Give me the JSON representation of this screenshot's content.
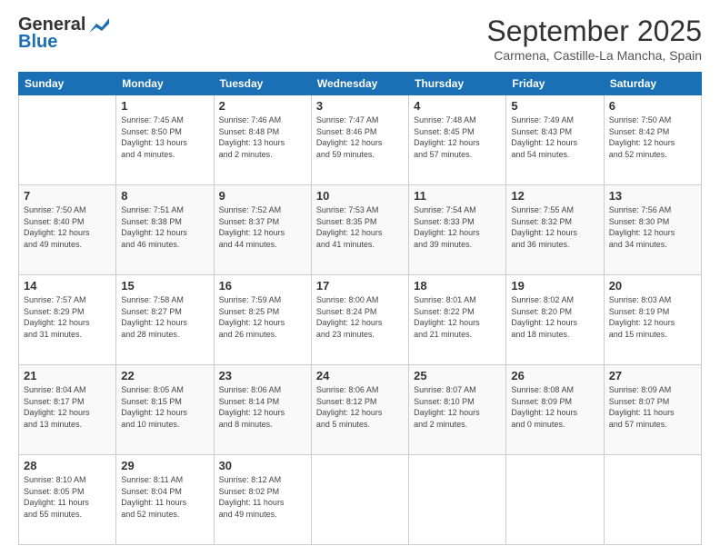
{
  "header": {
    "logo_general": "General",
    "logo_blue": "Blue",
    "title": "September 2025",
    "subtitle": "Carmena, Castille-La Mancha, Spain"
  },
  "days_of_week": [
    "Sunday",
    "Monday",
    "Tuesday",
    "Wednesday",
    "Thursday",
    "Friday",
    "Saturday"
  ],
  "weeks": [
    [
      {
        "day": "",
        "info": ""
      },
      {
        "day": "1",
        "info": "Sunrise: 7:45 AM\nSunset: 8:50 PM\nDaylight: 13 hours\nand 4 minutes."
      },
      {
        "day": "2",
        "info": "Sunrise: 7:46 AM\nSunset: 8:48 PM\nDaylight: 13 hours\nand 2 minutes."
      },
      {
        "day": "3",
        "info": "Sunrise: 7:47 AM\nSunset: 8:46 PM\nDaylight: 12 hours\nand 59 minutes."
      },
      {
        "day": "4",
        "info": "Sunrise: 7:48 AM\nSunset: 8:45 PM\nDaylight: 12 hours\nand 57 minutes."
      },
      {
        "day": "5",
        "info": "Sunrise: 7:49 AM\nSunset: 8:43 PM\nDaylight: 12 hours\nand 54 minutes."
      },
      {
        "day": "6",
        "info": "Sunrise: 7:50 AM\nSunset: 8:42 PM\nDaylight: 12 hours\nand 52 minutes."
      }
    ],
    [
      {
        "day": "7",
        "info": "Sunrise: 7:50 AM\nSunset: 8:40 PM\nDaylight: 12 hours\nand 49 minutes."
      },
      {
        "day": "8",
        "info": "Sunrise: 7:51 AM\nSunset: 8:38 PM\nDaylight: 12 hours\nand 46 minutes."
      },
      {
        "day": "9",
        "info": "Sunrise: 7:52 AM\nSunset: 8:37 PM\nDaylight: 12 hours\nand 44 minutes."
      },
      {
        "day": "10",
        "info": "Sunrise: 7:53 AM\nSunset: 8:35 PM\nDaylight: 12 hours\nand 41 minutes."
      },
      {
        "day": "11",
        "info": "Sunrise: 7:54 AM\nSunset: 8:33 PM\nDaylight: 12 hours\nand 39 minutes."
      },
      {
        "day": "12",
        "info": "Sunrise: 7:55 AM\nSunset: 8:32 PM\nDaylight: 12 hours\nand 36 minutes."
      },
      {
        "day": "13",
        "info": "Sunrise: 7:56 AM\nSunset: 8:30 PM\nDaylight: 12 hours\nand 34 minutes."
      }
    ],
    [
      {
        "day": "14",
        "info": "Sunrise: 7:57 AM\nSunset: 8:29 PM\nDaylight: 12 hours\nand 31 minutes."
      },
      {
        "day": "15",
        "info": "Sunrise: 7:58 AM\nSunset: 8:27 PM\nDaylight: 12 hours\nand 28 minutes."
      },
      {
        "day": "16",
        "info": "Sunrise: 7:59 AM\nSunset: 8:25 PM\nDaylight: 12 hours\nand 26 minutes."
      },
      {
        "day": "17",
        "info": "Sunrise: 8:00 AM\nSunset: 8:24 PM\nDaylight: 12 hours\nand 23 minutes."
      },
      {
        "day": "18",
        "info": "Sunrise: 8:01 AM\nSunset: 8:22 PM\nDaylight: 12 hours\nand 21 minutes."
      },
      {
        "day": "19",
        "info": "Sunrise: 8:02 AM\nSunset: 8:20 PM\nDaylight: 12 hours\nand 18 minutes."
      },
      {
        "day": "20",
        "info": "Sunrise: 8:03 AM\nSunset: 8:19 PM\nDaylight: 12 hours\nand 15 minutes."
      }
    ],
    [
      {
        "day": "21",
        "info": "Sunrise: 8:04 AM\nSunset: 8:17 PM\nDaylight: 12 hours\nand 13 minutes."
      },
      {
        "day": "22",
        "info": "Sunrise: 8:05 AM\nSunset: 8:15 PM\nDaylight: 12 hours\nand 10 minutes."
      },
      {
        "day": "23",
        "info": "Sunrise: 8:06 AM\nSunset: 8:14 PM\nDaylight: 12 hours\nand 8 minutes."
      },
      {
        "day": "24",
        "info": "Sunrise: 8:06 AM\nSunset: 8:12 PM\nDaylight: 12 hours\nand 5 minutes."
      },
      {
        "day": "25",
        "info": "Sunrise: 8:07 AM\nSunset: 8:10 PM\nDaylight: 12 hours\nand 2 minutes."
      },
      {
        "day": "26",
        "info": "Sunrise: 8:08 AM\nSunset: 8:09 PM\nDaylight: 12 hours\nand 0 minutes."
      },
      {
        "day": "27",
        "info": "Sunrise: 8:09 AM\nSunset: 8:07 PM\nDaylight: 11 hours\nand 57 minutes."
      }
    ],
    [
      {
        "day": "28",
        "info": "Sunrise: 8:10 AM\nSunset: 8:05 PM\nDaylight: 11 hours\nand 55 minutes."
      },
      {
        "day": "29",
        "info": "Sunrise: 8:11 AM\nSunset: 8:04 PM\nDaylight: 11 hours\nand 52 minutes."
      },
      {
        "day": "30",
        "info": "Sunrise: 8:12 AM\nSunset: 8:02 PM\nDaylight: 11 hours\nand 49 minutes."
      },
      {
        "day": "",
        "info": ""
      },
      {
        "day": "",
        "info": ""
      },
      {
        "day": "",
        "info": ""
      },
      {
        "day": "",
        "info": ""
      }
    ]
  ]
}
